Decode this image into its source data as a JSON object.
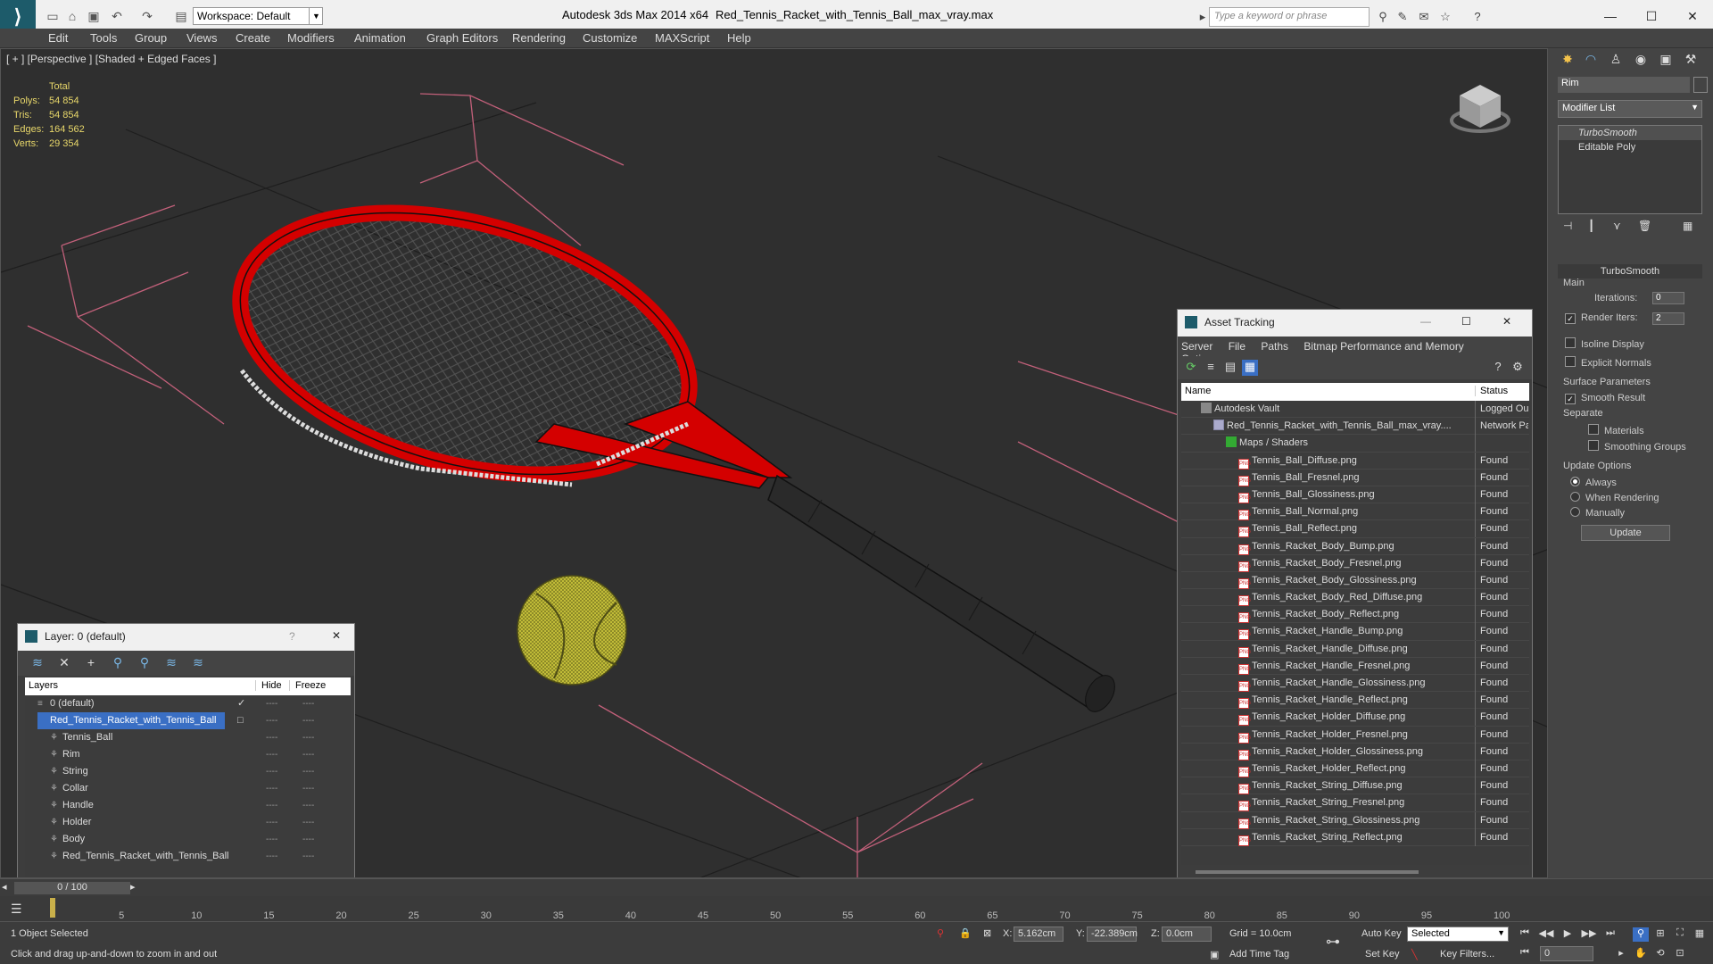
{
  "titlebar": {
    "workspace": "Workspace: Default",
    "app_title": "Autodesk 3ds Max  2014 x64",
    "doc_name": "Red_Tennis_Racket_with_Tennis_Ball_max_vray.max",
    "search_placeholder": "Type a keyword or phrase"
  },
  "menu": [
    "Edit",
    "Tools",
    "Group",
    "Views",
    "Create",
    "Modifiers",
    "Animation",
    "Graph Editors",
    "Rendering",
    "Customize",
    "MAXScript",
    "Help"
  ],
  "viewport": {
    "label": "[ + ] [Perspective ] [Shaded + Edged Faces ]",
    "stats_total": "Total",
    "stats": [
      {
        "k": "Polys:",
        "v": "54 854"
      },
      {
        "k": "Tris:",
        "v": "54 854"
      },
      {
        "k": "Edges:",
        "v": "164 562"
      },
      {
        "k": "Verts:",
        "v": "29 354"
      }
    ]
  },
  "layer_window": {
    "title": "Layer: 0 (default)",
    "help": "?",
    "col_layers": "Layers",
    "col_hide": "Hide",
    "col_freeze": "Freeze",
    "rows": [
      {
        "name": "0 (default)",
        "indent": 0,
        "selected": false,
        "mark": "✓"
      },
      {
        "name": "Red_Tennis_Racket_with_Tennis_Ball",
        "indent": 0,
        "selected": true,
        "mark": "□"
      },
      {
        "name": "Tennis_Ball",
        "indent": 1,
        "selected": false,
        "mark": ""
      },
      {
        "name": "Rim",
        "indent": 1,
        "selected": false,
        "mark": ""
      },
      {
        "name": "String",
        "indent": 1,
        "selected": false,
        "mark": ""
      },
      {
        "name": "Collar",
        "indent": 1,
        "selected": false,
        "mark": ""
      },
      {
        "name": "Handle",
        "indent": 1,
        "selected": false,
        "mark": ""
      },
      {
        "name": "Holder",
        "indent": 1,
        "selected": false,
        "mark": ""
      },
      {
        "name": "Body",
        "indent": 1,
        "selected": false,
        "mark": ""
      },
      {
        "name": "Red_Tennis_Racket_with_Tennis_Ball",
        "indent": 1,
        "selected": false,
        "mark": ""
      }
    ],
    "dash": "----"
  },
  "asset_window": {
    "title": "Asset Tracking",
    "menu": [
      "Server",
      "File",
      "Paths",
      "Bitmap Performance and Memory",
      "Options"
    ],
    "col_name": "Name",
    "col_status": "Status",
    "rows": [
      {
        "name": "Autodesk Vault",
        "status": "Logged Ou",
        "level": 0,
        "kind": "vault"
      },
      {
        "name": "Red_Tennis_Racket_with_Tennis_Ball_max_vray....",
        "status": "Network Pa",
        "level": 1,
        "kind": "file"
      },
      {
        "name": "Maps / Shaders",
        "status": "",
        "level": 2,
        "kind": "folder"
      },
      {
        "name": "Tennis_Ball_Diffuse.png",
        "status": "Found",
        "level": 3,
        "kind": "png"
      },
      {
        "name": "Tennis_Ball_Fresnel.png",
        "status": "Found",
        "level": 3,
        "kind": "png"
      },
      {
        "name": "Tennis_Ball_Glossiness.png",
        "status": "Found",
        "level": 3,
        "kind": "png"
      },
      {
        "name": "Tennis_Ball_Normal.png",
        "status": "Found",
        "level": 3,
        "kind": "png"
      },
      {
        "name": "Tennis_Ball_Reflect.png",
        "status": "Found",
        "level": 3,
        "kind": "png"
      },
      {
        "name": "Tennis_Racket_Body_Bump.png",
        "status": "Found",
        "level": 3,
        "kind": "png"
      },
      {
        "name": "Tennis_Racket_Body_Fresnel.png",
        "status": "Found",
        "level": 3,
        "kind": "png"
      },
      {
        "name": "Tennis_Racket_Body_Glossiness.png",
        "status": "Found",
        "level": 3,
        "kind": "png"
      },
      {
        "name": "Tennis_Racket_Body_Red_Diffuse.png",
        "status": "Found",
        "level": 3,
        "kind": "png"
      },
      {
        "name": "Tennis_Racket_Body_Reflect.png",
        "status": "Found",
        "level": 3,
        "kind": "png"
      },
      {
        "name": "Tennis_Racket_Handle_Bump.png",
        "status": "Found",
        "level": 3,
        "kind": "png"
      },
      {
        "name": "Tennis_Racket_Handle_Diffuse.png",
        "status": "Found",
        "level": 3,
        "kind": "png"
      },
      {
        "name": "Tennis_Racket_Handle_Fresnel.png",
        "status": "Found",
        "level": 3,
        "kind": "png"
      },
      {
        "name": "Tennis_Racket_Handle_Glossiness.png",
        "status": "Found",
        "level": 3,
        "kind": "png"
      },
      {
        "name": "Tennis_Racket_Handle_Reflect.png",
        "status": "Found",
        "level": 3,
        "kind": "png"
      },
      {
        "name": "Tennis_Racket_Holder_Diffuse.png",
        "status": "Found",
        "level": 3,
        "kind": "png"
      },
      {
        "name": "Tennis_Racket_Holder_Fresnel.png",
        "status": "Found",
        "level": 3,
        "kind": "png"
      },
      {
        "name": "Tennis_Racket_Holder_Glossiness.png",
        "status": "Found",
        "level": 3,
        "kind": "png"
      },
      {
        "name": "Tennis_Racket_Holder_Reflect.png",
        "status": "Found",
        "level": 3,
        "kind": "png"
      },
      {
        "name": "Tennis_Racket_String_Diffuse.png",
        "status": "Found",
        "level": 3,
        "kind": "png"
      },
      {
        "name": "Tennis_Racket_String_Fresnel.png",
        "status": "Found",
        "level": 3,
        "kind": "png"
      },
      {
        "name": "Tennis_Racket_String_Glossiness.png",
        "status": "Found",
        "level": 3,
        "kind": "png"
      },
      {
        "name": "Tennis_Racket_String_Reflect.png",
        "status": "Found",
        "level": 3,
        "kind": "png"
      }
    ]
  },
  "command_panel": {
    "object_name": "Rim",
    "modifier_list": "Modifier List",
    "stack": [
      "TurboSmooth",
      "Editable Poly"
    ],
    "rollout_title": "TurboSmooth",
    "main_label": "Main",
    "iterations_label": "Iterations:",
    "iterations_value": "0",
    "render_iters_label": "Render Iters:",
    "render_iters_value": "2",
    "render_iters_checked": true,
    "isoline": "Isoline Display",
    "explicit_normals": "Explicit Normals",
    "surface_params": "Surface Parameters",
    "smooth_result": "Smooth Result",
    "separate": "Separate",
    "materials": "Materials",
    "smoothing_groups": "Smoothing Groups",
    "update_options": "Update Options",
    "always": "Always",
    "when_rendering": "When Rendering",
    "manually": "Manually",
    "update_button": "Update"
  },
  "timeline": {
    "frame": "0 / 100",
    "ticks": [
      "5",
      "10",
      "15",
      "20",
      "25",
      "30",
      "35",
      "40",
      "45",
      "50",
      "55",
      "60",
      "65",
      "70",
      "75",
      "80",
      "85",
      "90",
      "95",
      "100"
    ]
  },
  "status": {
    "selected": "1 Object Selected",
    "prompt": "Click and drag up-and-down to zoom in and out",
    "x_label": "X:",
    "x_value": "5.162cm",
    "y_label": "Y:",
    "y_value": "-22.389cm",
    "z_label": "Z:",
    "z_value": "0.0cm",
    "grid": "Grid = 10.0cm",
    "auto_key": "Auto Key",
    "set_key": "Set Key",
    "selected_dropdown": "Selected",
    "key_filters": "Key Filters...",
    "add_time_tag": "Add Time Tag",
    "frame_field": "0"
  },
  "colors": {
    "accent": "#3a6fc4",
    "racket_red": "#d40000",
    "ball": "#c8c23a"
  }
}
